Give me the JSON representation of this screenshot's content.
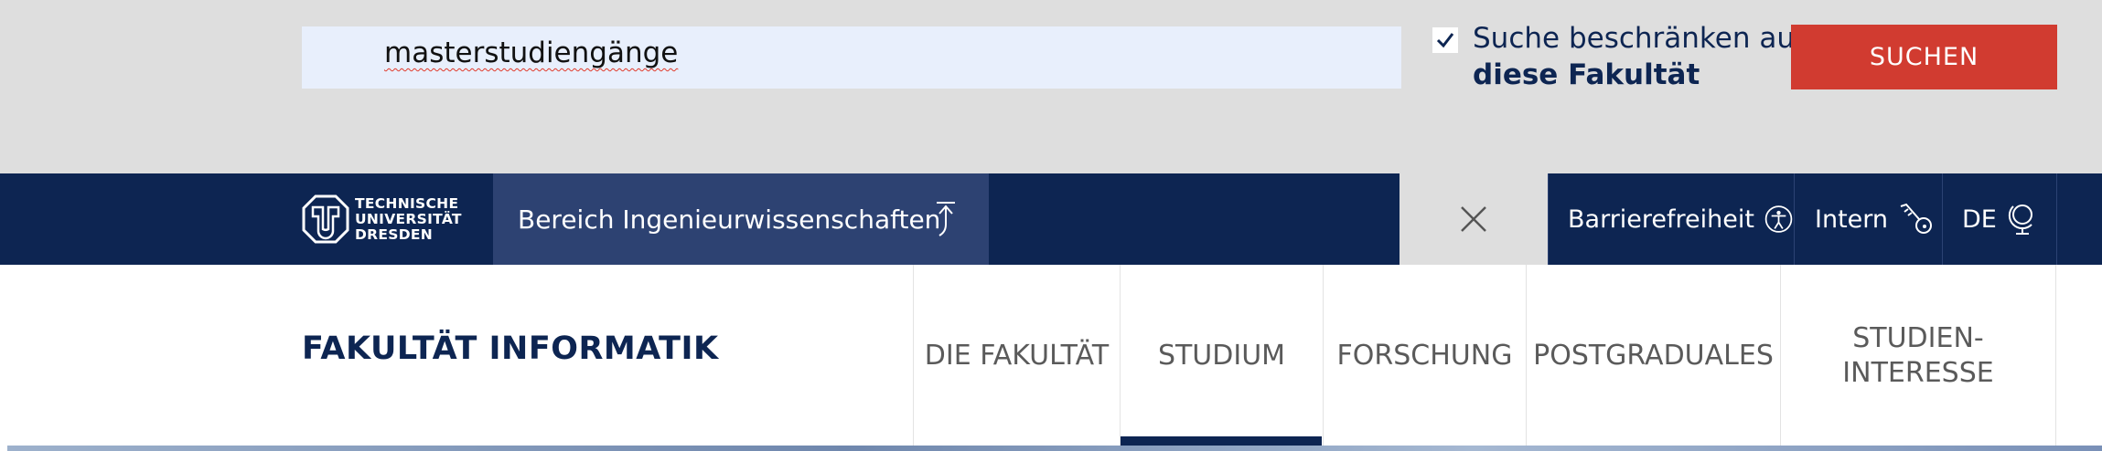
{
  "search": {
    "query": "masterstudiengänge",
    "restrict_label_line1": "Suche beschränken auf",
    "restrict_label_line2": "diese Fakultät",
    "restrict_checked": true,
    "button_label": "SUCHEN"
  },
  "topnav": {
    "logo_line1": "TECHNISCHE",
    "logo_line2": "UNIVERSITÄT",
    "logo_line3": "DRESDEN",
    "area_link": "Bereich Ingenieurwissenschaften",
    "accessibility": "Barrierefreiheit",
    "intern": "Intern",
    "language": "DE"
  },
  "mainnav": {
    "faculty_title": "FAKULTÄT INFORMATIK",
    "tabs": [
      {
        "label": "DIE FAKULTÄT"
      },
      {
        "label": "STUDIUM",
        "active": true
      },
      {
        "label": "FORSCHUNG"
      },
      {
        "label": "POSTGRADUALES"
      },
      {
        "label": "STUDIEN-\nINTERESSE"
      }
    ]
  },
  "colors": {
    "brand_navy": "#0d2552",
    "search_red": "#d13b30",
    "search_bg": "#dedede",
    "input_bg": "#e8effc"
  },
  "icons": {
    "checkbox": "check-icon",
    "area_link": "arrow-up-icon",
    "close": "close-icon",
    "accessibility": "accessibility-icon",
    "intern": "key-icon",
    "language": "globe-icon"
  }
}
